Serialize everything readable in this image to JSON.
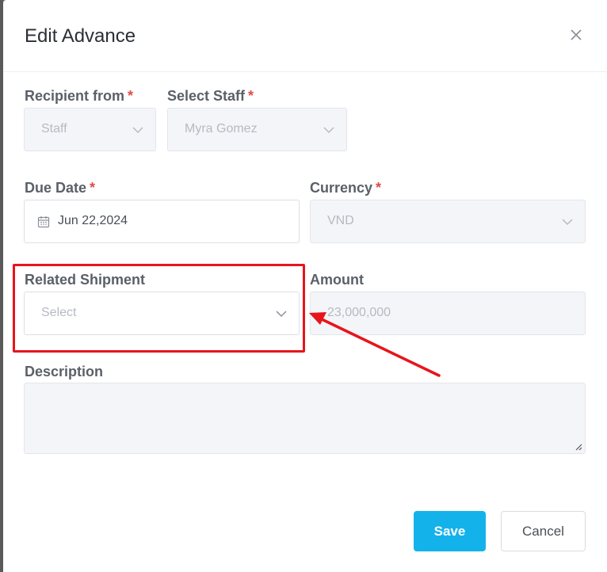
{
  "modal": {
    "title": "Edit Advance",
    "close_icon": "close-icon"
  },
  "form": {
    "recipient_from": {
      "label": "Recipient from",
      "required_mark": "*",
      "value": "Staff"
    },
    "select_staff": {
      "label": "Select Staff",
      "required_mark": "*",
      "value": "Myra Gomez"
    },
    "due_date": {
      "label": "Due Date",
      "required_mark": "*",
      "value": "Jun 22,2024",
      "icon": "calendar-icon"
    },
    "currency": {
      "label": "Currency",
      "required_mark": "*",
      "value": "VND"
    },
    "related_shipment": {
      "label": "Related Shipment",
      "placeholder": "Select"
    },
    "amount": {
      "label": "Amount",
      "value": "23,000,000"
    },
    "description": {
      "label": "Description",
      "value": ""
    }
  },
  "footer": {
    "save_label": "Save",
    "cancel_label": "Cancel"
  },
  "colors": {
    "accent": "#14b2ea",
    "required": "#e24a4a",
    "annotation": "#e8141c"
  }
}
